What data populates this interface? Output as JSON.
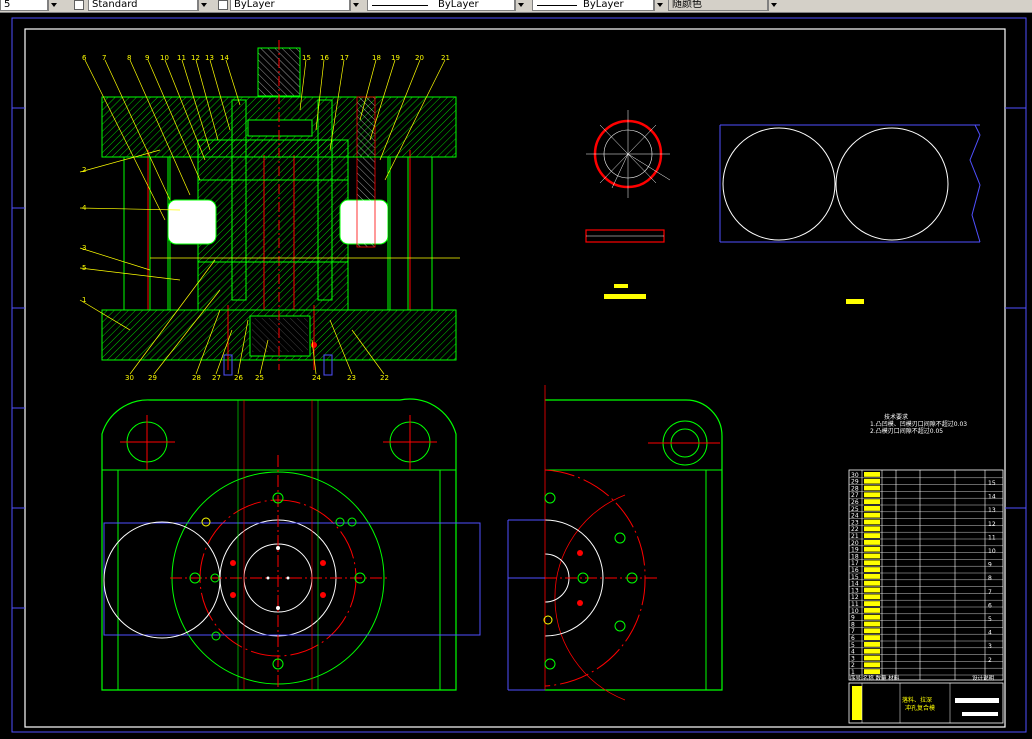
{
  "toolbar": {
    "left_value": "5",
    "textstyle": "Standard",
    "layer": "ByLayer",
    "linetype": "ByLayer",
    "lineweight": "ByLayer",
    "color": "随颜色"
  },
  "section_numbers_top": [
    "6",
    "7",
    "8",
    "9",
    "10",
    "11",
    "12",
    "13",
    "14",
    "15",
    "16",
    "17",
    "18",
    "19",
    "20",
    "21"
  ],
  "section_numbers_left": [
    "2",
    "4",
    "3",
    "5",
    "1"
  ],
  "section_numbers_bottom": [
    "30",
    "29",
    "28",
    "27",
    "26",
    "25",
    "24",
    "23",
    "22"
  ],
  "tech_requirements": {
    "title": "技术要求",
    "line1": "1.凸凹模、凹模刃口间隙不超过0.03",
    "line2": "2.凸模刃口间隙不超过0.05"
  },
  "bom": {
    "row_numbers": [
      "30",
      "29",
      "28",
      "27",
      "26",
      "25",
      "24",
      "23",
      "22",
      "21",
      "20",
      "19",
      "18",
      "17",
      "16",
      "15",
      "14",
      "13",
      "12",
      "11",
      "10",
      "9",
      "8",
      "7",
      "6",
      "5",
      "4",
      "3",
      "2",
      "1"
    ],
    "right_index": [
      "15",
      "14",
      "13",
      "12",
      "11",
      "10",
      "9",
      "8",
      "7",
      "6",
      "5",
      "4",
      "3",
      "2"
    ],
    "header": "序号  名称  数量  材料",
    "title_left": "落料、拉深",
    "title_left2": "冲孔复合模",
    "title_tag": "设计说明"
  },
  "colors": {
    "green": "#00ff00",
    "red": "#ff0000",
    "yellow": "#ffff00",
    "white": "#ffffff",
    "blue": "#5050ff",
    "toolbar": "#d4d0c8"
  }
}
